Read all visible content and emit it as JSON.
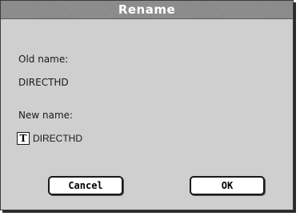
{
  "dialog": {
    "title": "Rename",
    "old_name_label": "Old name:",
    "old_name_value": "DIRECTHD",
    "new_name_label": "New name:",
    "new_name_value": "DIRECTHD",
    "text_tool_glyph": "T",
    "cancel_label": "Cancel",
    "ok_label": "OK"
  }
}
